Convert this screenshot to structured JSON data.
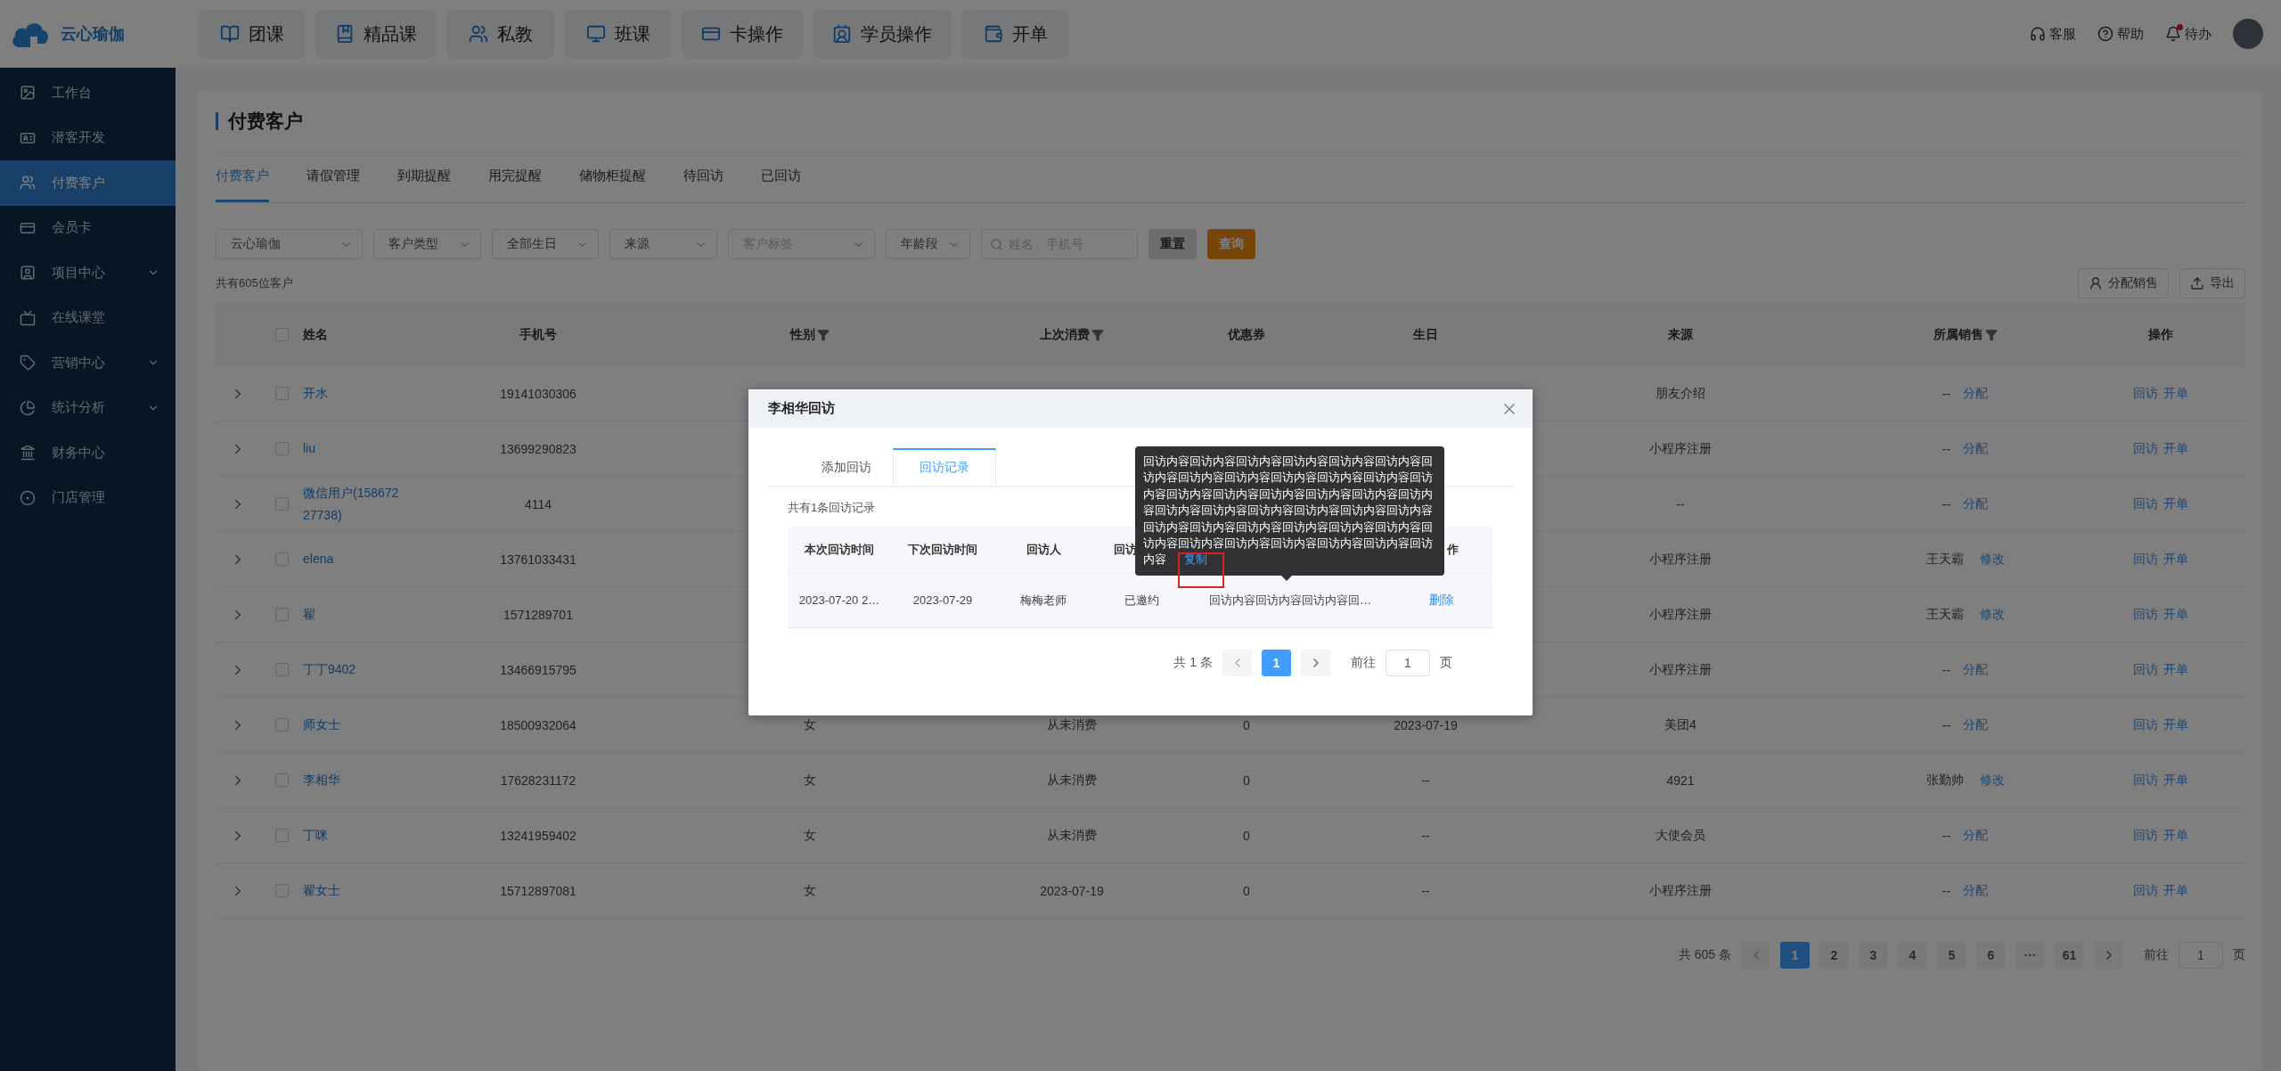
{
  "brand": {
    "name": "云心瑜伽"
  },
  "top_nav": [
    {
      "label": "团课"
    },
    {
      "label": "精品课"
    },
    {
      "label": "私教"
    },
    {
      "label": "班课"
    },
    {
      "label": "卡操作"
    },
    {
      "label": "学员操作"
    },
    {
      "label": "开单"
    }
  ],
  "header_actions": [
    {
      "label": "客服",
      "notification": false
    },
    {
      "label": "帮助",
      "notification": false
    },
    {
      "label": "待办",
      "notification": true
    }
  ],
  "sidebar": {
    "items": [
      {
        "label": "工作台",
        "kind": "link",
        "selected": false
      },
      {
        "label": "潜客开发",
        "kind": "link",
        "selected": false
      },
      {
        "label": "付费客户",
        "kind": "link",
        "selected": true
      },
      {
        "label": "会员卡",
        "kind": "link",
        "selected": false
      },
      {
        "label": "项目中心",
        "kind": "group",
        "selected": false
      },
      {
        "label": "在线课堂",
        "kind": "link",
        "selected": false
      },
      {
        "label": "营销中心",
        "kind": "group",
        "selected": false
      },
      {
        "label": "统计分析",
        "kind": "group",
        "selected": false
      },
      {
        "label": "财务中心",
        "kind": "link",
        "selected": false
      },
      {
        "label": "门店管理",
        "kind": "link",
        "selected": false
      }
    ]
  },
  "page": {
    "title": "付费客户"
  },
  "tabs": [
    {
      "label": "付费客户",
      "selected": true
    },
    {
      "label": "请假管理",
      "selected": false
    },
    {
      "label": "到期提醒",
      "selected": false
    },
    {
      "label": "用完提醒",
      "selected": false
    },
    {
      "label": "储物柜提醒",
      "selected": false
    },
    {
      "label": "待回访",
      "selected": false
    },
    {
      "label": "已回访",
      "selected": false
    }
  ],
  "filters": [
    {
      "kind": "select",
      "value": "云心瑜伽"
    },
    {
      "kind": "select",
      "value": "客户类型"
    },
    {
      "kind": "select",
      "value": "全部生日"
    },
    {
      "kind": "select",
      "value": "来源"
    },
    {
      "kind": "select",
      "placeholder": "客户标签"
    },
    {
      "kind": "select",
      "value": "年龄段"
    },
    {
      "kind": "search",
      "placeholder": "姓名、手机号"
    }
  ],
  "filter_buttons": [
    {
      "label": "重置",
      "kind": "default"
    },
    {
      "label": "查询",
      "kind": "primary"
    }
  ],
  "customer_count": "共有605位客户",
  "toolbar_buttons": [
    {
      "label": "分配销售"
    },
    {
      "label": "导出"
    }
  ],
  "table": {
    "header_checked": false,
    "columns": [
      {
        "label": "姓名",
        "filterable": false
      },
      {
        "label": "手机号",
        "filterable": false
      },
      {
        "label": "性别",
        "filterable": true
      },
      {
        "label": "上次消费",
        "filterable": true
      },
      {
        "label": "优惠券",
        "filterable": false
      },
      {
        "label": "生日",
        "filterable": false
      },
      {
        "label": "来源",
        "filterable": false
      },
      {
        "label": "所属销售",
        "filterable": true
      },
      {
        "label": "操作",
        "filterable": false
      }
    ],
    "rows": [
      {
        "expanded": false,
        "checked": false,
        "name": "开水",
        "phone": "19141030306",
        "source": "朋友介绍",
        "sales": "--",
        "sales_action": "分配",
        "actions": [
          "回访",
          "开单"
        ]
      },
      {
        "expanded": false,
        "checked": false,
        "name": "liu",
        "phone": "13699290823",
        "source": "小程序注册",
        "sales": "--",
        "sales_action": "分配",
        "actions": [
          "回访",
          "开单"
        ]
      },
      {
        "expanded": false,
        "checked": false,
        "name": "微信用户(15867227738)",
        "phone": "4114",
        "source": "--",
        "sales": "--",
        "sales_action": "分配",
        "actions": [
          "回访",
          "开单"
        ]
      },
      {
        "expanded": false,
        "checked": false,
        "name": "elena",
        "phone": "13761033431",
        "source": "小程序注册",
        "sales": "王天霸",
        "sales_action": "修改",
        "actions": [
          "回访",
          "开单"
        ]
      },
      {
        "expanded": false,
        "checked": false,
        "name": "翟",
        "phone": "1571289701",
        "source": "小程序注册",
        "sales": "王天霸",
        "sales_action": "修改",
        "actions": [
          "回访",
          "开单"
        ]
      },
      {
        "expanded": false,
        "checked": false,
        "name": "丁丁9402",
        "phone": "13466915795",
        "source": "小程序注册",
        "sales": "--",
        "sales_action": "分配",
        "actions": [
          "回访",
          "开单"
        ]
      },
      {
        "expanded": false,
        "checked": false,
        "name": "师女士",
        "phone": "18500932064",
        "gender": "女",
        "last_purchase": "从未消费",
        "coupon": "0",
        "birthday": "2023-07-19",
        "source": "美团4",
        "sales": "--",
        "sales_action": "分配",
        "actions": [
          "回访",
          "开单"
        ]
      },
      {
        "expanded": false,
        "checked": false,
        "name": "李相华",
        "phone": "17628231172",
        "gender": "女",
        "last_purchase": "从未消费",
        "coupon": "0",
        "birthday": "--",
        "source": "4921",
        "sales": "张勤帅",
        "sales_action": "修改",
        "actions": [
          "回访",
          "开单"
        ]
      },
      {
        "expanded": false,
        "checked": false,
        "name": "丁咪",
        "phone": "13241959402",
        "gender": "女",
        "last_purchase": "从未消费",
        "coupon": "0",
        "birthday": "--",
        "source": "大使会员",
        "sales": "--",
        "sales_action": "分配",
        "actions": [
          "回访",
          "开单"
        ]
      },
      {
        "expanded": false,
        "checked": false,
        "name": "翟女士",
        "phone": "15712897081",
        "gender": "女",
        "last_purchase": "2023-07-19",
        "coupon": "0",
        "birthday": "--",
        "source": "小程序注册",
        "sales": "--",
        "sales_action": "分配",
        "actions": [
          "回访",
          "开单"
        ]
      }
    ]
  },
  "pagination": {
    "total": "共 605 条",
    "pages": [
      {
        "label": "1",
        "selected": true
      },
      {
        "label": "2",
        "selected": false
      },
      {
        "label": "3",
        "selected": false
      },
      {
        "label": "4",
        "selected": false
      },
      {
        "label": "5",
        "selected": false
      },
      {
        "label": "6",
        "selected": false
      },
      {
        "label": "···",
        "selected": false
      },
      {
        "label": "61",
        "selected": false
      }
    ],
    "goto_label": "前往",
    "goto_value": "1",
    "goto_suffix": "页"
  },
  "modal": {
    "title": "李相华回访",
    "tabs": [
      {
        "label": "添加回访",
        "selected": false
      },
      {
        "label": "回访记录",
        "selected": true
      }
    ],
    "record_count": "共有1条回访记录",
    "columns": [
      "本次回访时间",
      "下次回访时间",
      "回访人",
      "回访",
      null,
      "作"
    ],
    "rows": [
      {
        "cells": [
          "2023-07-20 2…",
          "2023-07-29",
          "梅梅老师",
          "已邀约",
          "回访内容回访内容回访内容回…"
        ],
        "actions": [
          "删除"
        ]
      }
    ],
    "pagination": {
      "total": "共 1 条",
      "pages": [
        {
          "label": "1",
          "selected": true
        }
      ],
      "goto_label": "前往",
      "goto_value": "1",
      "goto_suffix": "页"
    },
    "tooltip": {
      "text": "回访内容回访内容回访内容回访内容回访内容回访内容回访内容回访内容回访内容回访内容回访内容回访内容回访内容回访内容回访内容回访内容回访内容回访内容回访内容回访内容回访内容回访内容回访内容回访内容回访内容回访内容回访内容回访内容回访内容回访内容回访内容回访内容回访内容回访内容回访内容回访内容回访内容回访内容",
      "action": "复制",
      "highlighted": true
    }
  }
}
